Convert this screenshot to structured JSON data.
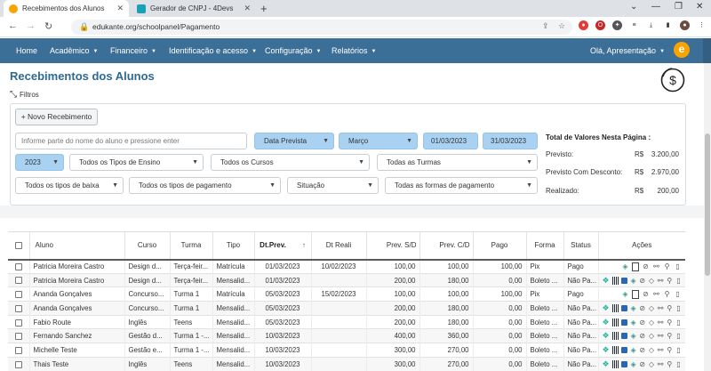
{
  "browser": {
    "tabs": [
      {
        "title": "Recebimentos dos Alunos",
        "active": true
      },
      {
        "title": "Gerador de CNPJ - 4Devs",
        "active": false
      }
    ],
    "url": "edukante.org/schoolpanel/Pagamento"
  },
  "navbar": {
    "home": "Home",
    "academico": "Acadêmico",
    "financeiro": "Financeiro",
    "identificacao": "Identificação e acesso",
    "configuracao": "Configuração",
    "relatorios": "Relatórios",
    "user": "Olá, Apresentação",
    "logo_letter": "e"
  },
  "page": {
    "title": "Recebimentos dos Alunos",
    "filters_label": "Filtros",
    "new_button": "+ Novo Recebimento"
  },
  "filters": {
    "search_placeholder": "Informe parte do nome do aluno e pressione enter",
    "date_type": "Data Prevista",
    "month": "Março",
    "date_from": "01/03/2023",
    "date_to": "31/03/2023",
    "year": "2023",
    "tipos_ensino": "Todos os Tipos de Ensino",
    "cursos": "Todos os Cursos",
    "turmas": "Todas as Turmas",
    "tipos_baixa": "Todos os tipos de baixa",
    "tipos_pagamento": "Todos os tipos de pagamento",
    "situacao": "Situação",
    "formas_pagamento": "Todas as formas de pagamento"
  },
  "totals": {
    "title": "Total de Valores Nesta Página :",
    "rows": [
      {
        "label": "Previsto:",
        "currency": "R$",
        "value": "3.200,00"
      },
      {
        "label": "Previsto Com Desconto:",
        "currency": "R$",
        "value": "2.970,00"
      },
      {
        "label": "Realizado:",
        "currency": "R$",
        "value": "200,00"
      }
    ]
  },
  "table": {
    "headers": {
      "aluno": "Aluno",
      "curso": "Curso",
      "turma": "Turma",
      "tipo": "Tipo",
      "dt_prev": "Dt.Prev.",
      "dt_real": "Dt Reali",
      "prev_sd": "Prev. S/D",
      "prev_cd": "Prev. C/D",
      "pago": "Pago",
      "forma": "Forma",
      "status": "Status",
      "acoes": "Ações"
    },
    "rows": [
      {
        "aluno": "Patricia Moreira Castro",
        "curso": "Design d...",
        "turma": "Terça-feir...",
        "tipo": "Matrícula",
        "dt_prev": "01/03/2023",
        "dt_real": "10/02/2023",
        "prev_sd": "100,00",
        "prev_cd": "100,00",
        "pago": "100,00",
        "forma": "Pix",
        "status": "Pago"
      },
      {
        "aluno": "Patricia Moreira Castro",
        "curso": "Design d...",
        "turma": "Terça-feir...",
        "tipo": "Mensalid...",
        "dt_prev": "01/03/2023",
        "dt_real": "",
        "prev_sd": "200,00",
        "prev_cd": "180,00",
        "pago": "0,00",
        "forma": "Boleto ...",
        "status": "Não Pa..."
      },
      {
        "aluno": "Ananda Gonçalves",
        "curso": "Concurso...",
        "turma": "Turma 1",
        "tipo": "Matrícula",
        "dt_prev": "05/03/2023",
        "dt_real": "15/02/2023",
        "prev_sd": "100,00",
        "prev_cd": "100,00",
        "pago": "100,00",
        "forma": "Pix",
        "status": "Pago"
      },
      {
        "aluno": "Ananda Gonçalves",
        "curso": "Concurso...",
        "turma": "Turma 1",
        "tipo": "Mensalid...",
        "dt_prev": "05/03/2023",
        "dt_real": "",
        "prev_sd": "200,00",
        "prev_cd": "180,00",
        "pago": "0,00",
        "forma": "Boleto ...",
        "status": "Não Pa..."
      },
      {
        "aluno": "Fabio Route",
        "curso": "Inglês",
        "turma": "Teens",
        "tipo": "Mensalid...",
        "dt_prev": "05/03/2023",
        "dt_real": "",
        "prev_sd": "200,00",
        "prev_cd": "180,00",
        "pago": "0,00",
        "forma": "Boleto ...",
        "status": "Não Pa..."
      },
      {
        "aluno": "Fernando Sanchez",
        "curso": "Gestão d...",
        "turma": "Turma 1 -...",
        "tipo": "Mensalid...",
        "dt_prev": "10/03/2023",
        "dt_real": "",
        "prev_sd": "400,00",
        "prev_cd": "360,00",
        "pago": "0,00",
        "forma": "Boleto ...",
        "status": "Não Pa..."
      },
      {
        "aluno": "Michelle Teste",
        "curso": "Gestão e...",
        "turma": "Turma 1 -...",
        "tipo": "Mensalid...",
        "dt_prev": "10/03/2023",
        "dt_real": "",
        "prev_sd": "300,00",
        "prev_cd": "270,00",
        "pago": "0,00",
        "forma": "Boleto ...",
        "status": "Não Pa..."
      },
      {
        "aluno": "Thais Teste",
        "curso": "Inglês",
        "turma": "Teens",
        "tipo": "Mensalid...",
        "dt_prev": "10/03/2023",
        "dt_real": "",
        "prev_sd": "300,00",
        "prev_cd": "270,00",
        "pago": "0,00",
        "forma": "Boleto ...",
        "status": "Não Pa..."
      }
    ]
  },
  "colors": {
    "navbar": "#3c6f97",
    "title": "#2d6a93",
    "filter_highlight": "#a9d2f2",
    "logo": "#f7a400"
  }
}
